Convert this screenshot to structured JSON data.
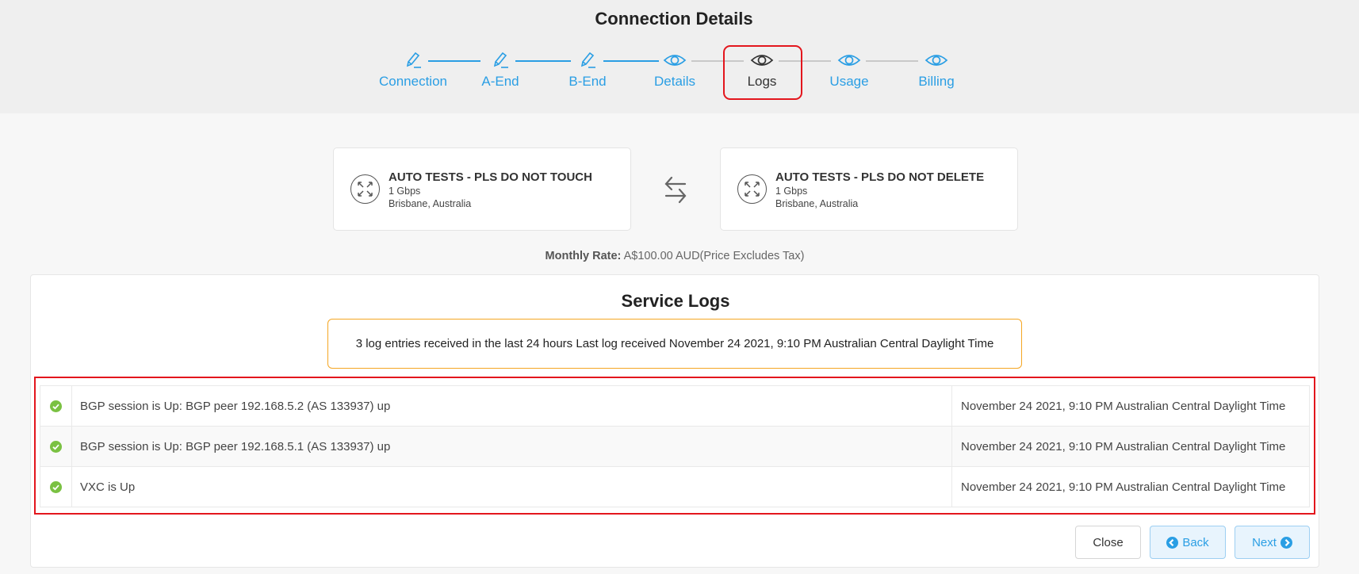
{
  "page": {
    "title": "Connection Details"
  },
  "steps": [
    {
      "label": "Connection",
      "icon": "pencil-icon",
      "state": "completed"
    },
    {
      "label": "A-End",
      "icon": "pencil-icon",
      "state": "completed"
    },
    {
      "label": "B-End",
      "icon": "pencil-icon",
      "state": "completed"
    },
    {
      "label": "Details",
      "icon": "eye-icon",
      "state": "completed"
    },
    {
      "label": "Logs",
      "icon": "eye-icon",
      "state": "active"
    },
    {
      "label": "Usage",
      "icon": "eye-icon",
      "state": "upcoming"
    },
    {
      "label": "Billing",
      "icon": "eye-icon",
      "state": "upcoming"
    }
  ],
  "a_end": {
    "name": "AUTO TESTS - PLS DO NOT TOUCH",
    "speed": "1 Gbps",
    "location": "Brisbane, Australia",
    "icon": "port-icon"
  },
  "b_end": {
    "name": "AUTO TESTS - PLS DO NOT DELETE",
    "speed": "1 Gbps",
    "location": "Brisbane, Australia",
    "icon": "port-icon"
  },
  "rate": {
    "label": "Monthly Rate:",
    "value": "A$100.00 AUD(Price Excludes Tax)"
  },
  "service_logs": {
    "title": "Service Logs",
    "summary": "3 log entries received in the last 24 hours Last log received November 24 2021, 9:10 PM Australian Central Daylight Time",
    "entries": [
      {
        "status": "ok",
        "message": "BGP session is Up: BGP peer 192.168.5.2 (AS 133937) up",
        "time": "November 24 2021, 9:10 PM Australian Central Daylight Time"
      },
      {
        "status": "ok",
        "message": "BGP session is Up: BGP peer 192.168.5.1 (AS 133937) up",
        "time": "November 24 2021, 9:10 PM Australian Central Daylight Time"
      },
      {
        "status": "ok",
        "message": "VXC is Up",
        "time": "November 24 2021, 9:10 PM Australian Central Daylight Time"
      }
    ]
  },
  "buttons": {
    "close": "Close",
    "back": "Back",
    "next": "Next"
  },
  "colors": {
    "accent": "#2a9ee4",
    "ok": "#7ac142",
    "highlight": "#e3161d",
    "warning_border": "#f5a623"
  }
}
